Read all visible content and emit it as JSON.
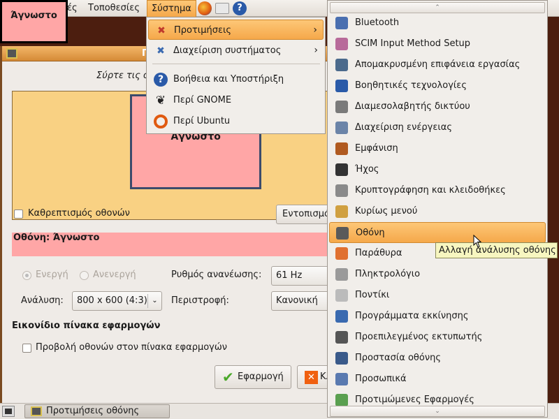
{
  "top_panel": {
    "menus": [
      "Εφαρμογές",
      "Τοποθεσίες",
      "Σύστημα"
    ],
    "visible_partial": "ές",
    "launchers": [
      "firefox-icon",
      "mail-icon",
      "help-icon"
    ]
  },
  "overlay_label": "Άγνωστο",
  "window": {
    "title_partial": "Π",
    "instructions": "Σύρτε τις οθόνες",
    "monitor_label": "Άγνωστο",
    "mirror_label": "Καθρεπτισμός οθονών",
    "detect_button": "Εντοπισμός οθονών",
    "monitor_header": "Οθόνη: Άγνωστο",
    "on_label": "Ενεργή",
    "off_label": "Ανενεργή",
    "refresh_label": "Ρυθμός ανανέωσης:",
    "refresh_value": "61 Hz",
    "resolution_label": "Ανάλυση:",
    "resolution_value": "800 x 600 (4:3)",
    "rotation_label": "Περιστροφή:",
    "rotation_value": "Κανονική",
    "panel_heading": "Εικονίδιο πίνακα εφαρμογών",
    "panel_checkbox": "Προβολή οθονών στον πίνακα εφαρμογών",
    "apply_button": "Εφαρμογή",
    "close_button": "Κλείσιμο",
    "colors": {
      "monitor_area": "#f9d183",
      "monitor": "#ffa6a6",
      "accent": "#f5a84a"
    }
  },
  "system_menu": {
    "items": [
      {
        "label": "Προτιμήσεις",
        "icon": "preferences-icon",
        "submenu": true,
        "highlighted": true
      },
      {
        "label": "Διαχείριση συστήματος",
        "icon": "administration-icon",
        "submenu": true
      },
      {
        "label": "Βοήθεια και Υποστήριξη",
        "icon": "help-icon"
      },
      {
        "label": "Περί GNOME",
        "icon": "gnome-foot-icon"
      },
      {
        "label": "Περί Ubuntu",
        "icon": "ubuntu-icon"
      }
    ]
  },
  "preferences_menu": {
    "items": [
      {
        "label": "Bluetooth",
        "icon": "bluetooth-icon",
        "color": "#4a6fb0"
      },
      {
        "label": "SCIM Input Method Setup",
        "icon": "scim-icon",
        "color": "#b86a9a"
      },
      {
        "label": "Απομακρυσμένη επιφάνεια εργασίας",
        "icon": "remote-desktop-icon",
        "color": "#4b6a8c"
      },
      {
        "label": "Βοηθητικές τεχνολογίες",
        "icon": "accessibility-icon",
        "color": "#2a5aa8"
      },
      {
        "label": "Διαμεσολαβητής δικτύου",
        "icon": "network-proxy-icon",
        "color": "#7a7a7a"
      },
      {
        "label": "Διαχείριση ενέργειας",
        "icon": "power-icon",
        "color": "#6b84a8"
      },
      {
        "label": "Εμφάνιση",
        "icon": "appearance-icon",
        "color": "#b05a20"
      },
      {
        "label": "Ήχος",
        "icon": "sound-icon",
        "color": "#333333"
      },
      {
        "label": "Κρυπτογράφηση και κλειδοθήκες",
        "icon": "keyring-icon",
        "color": "#8a8a8a"
      },
      {
        "label": "Κυρίως μενού",
        "icon": "main-menu-icon",
        "color": "#d0a040"
      },
      {
        "label": "Οθόνη",
        "icon": "display-icon",
        "color": "#5a5a5a",
        "highlighted": true
      },
      {
        "label": "Παράθυρα",
        "icon": "windows-icon",
        "color": "#e07030"
      },
      {
        "label": "Πληκτρολόγιο",
        "icon": "keyboard-icon",
        "color": "#9a9a9a"
      },
      {
        "label": "Ποντίκι",
        "icon": "mouse-icon",
        "color": "#bbbbbb"
      },
      {
        "label": "Προγράμματα εκκίνησης",
        "icon": "startup-icon",
        "color": "#3a6ab0"
      },
      {
        "label": "Προεπιλεγμένος εκτυπωτής",
        "icon": "printer-icon",
        "color": "#555555"
      },
      {
        "label": "Προστασία οθόνης",
        "icon": "screensaver-icon",
        "color": "#3a5a8a"
      },
      {
        "label": "Προσωπικά",
        "icon": "personal-icon",
        "color": "#5a7ab0"
      },
      {
        "label": "Προτιμώμενες Εφαρμογές",
        "icon": "preferred-apps-icon",
        "color": "#5aa050"
      }
    ]
  },
  "tooltip": "Αλλαγή ανάλυσης οθόνης",
  "taskbar": {
    "items": [
      {
        "label": "Προτιμήσεις οθόνης"
      }
    ]
  }
}
